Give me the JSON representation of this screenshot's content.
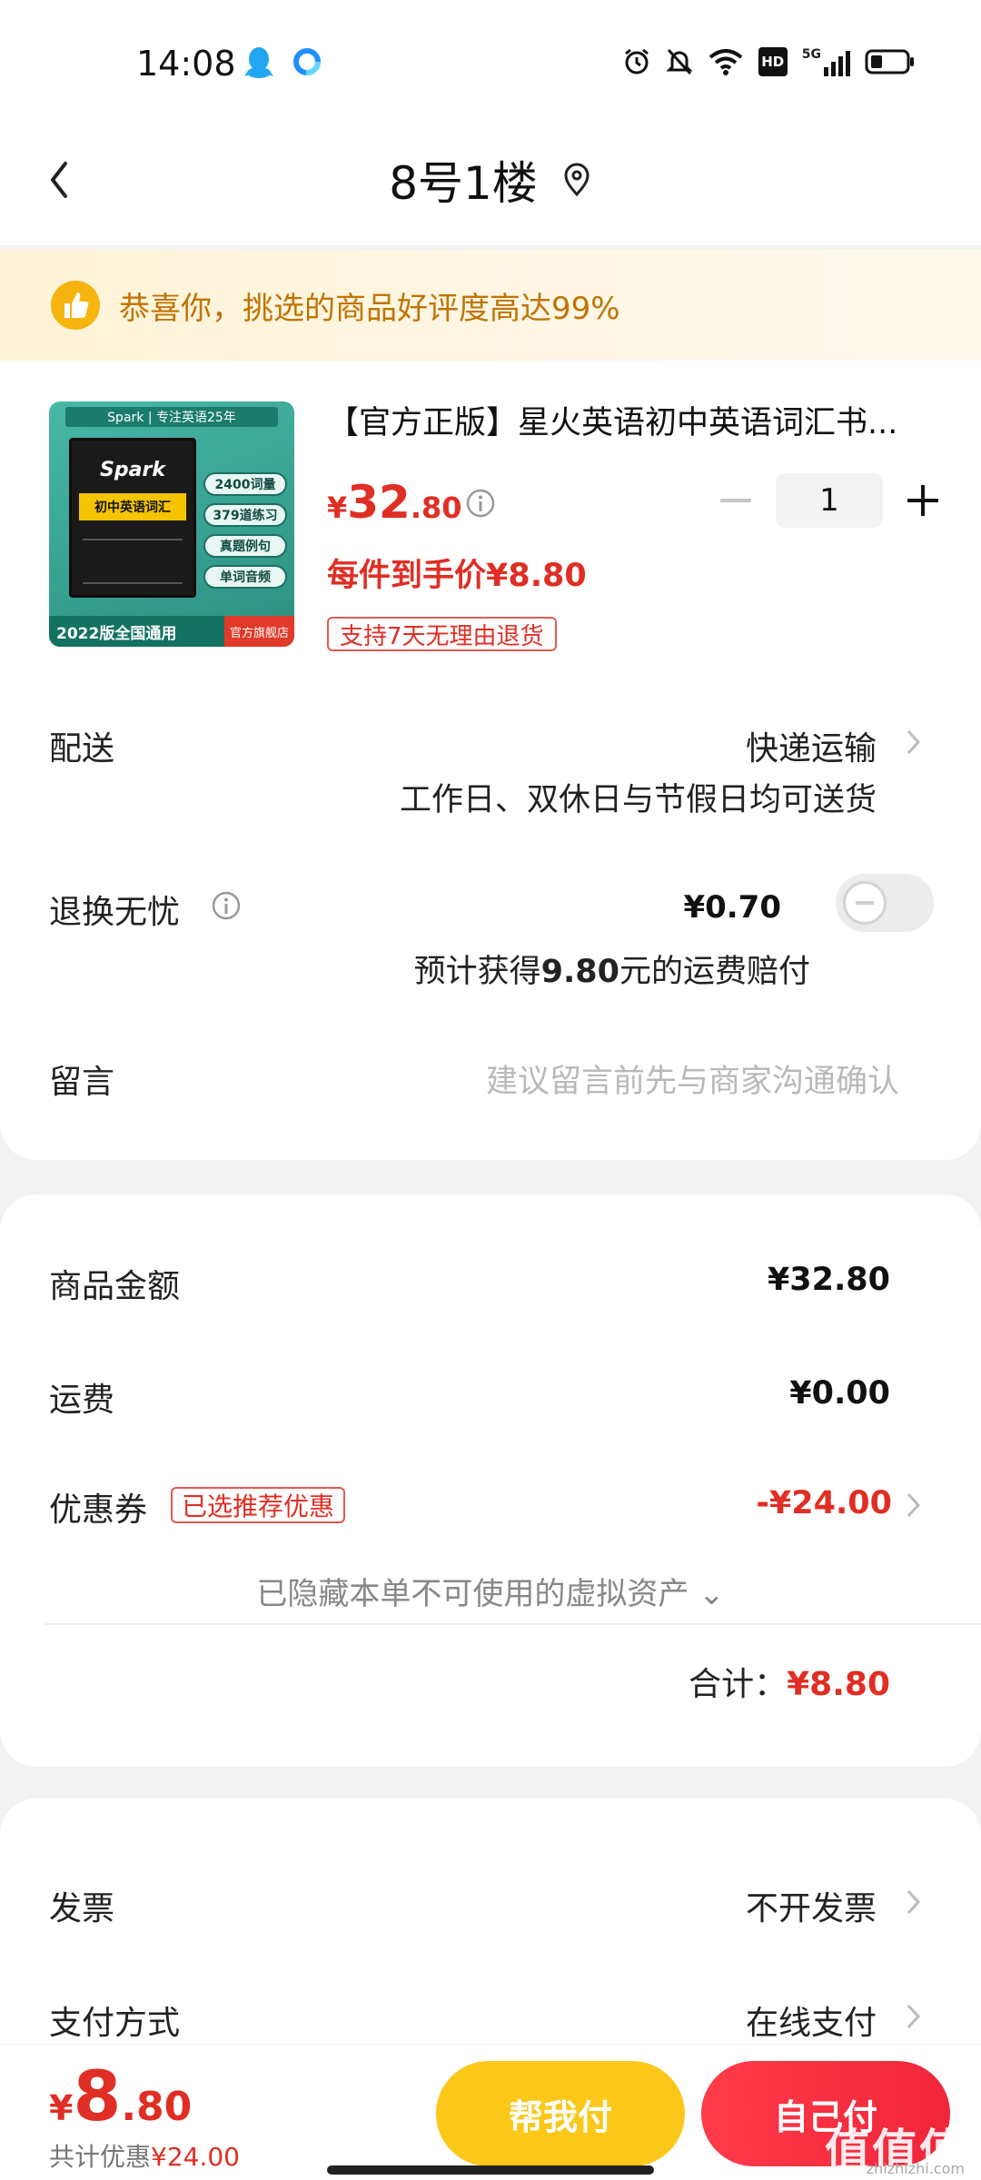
{
  "status_bar": {
    "time": "14:08",
    "hd": "HD",
    "net": "5G"
  },
  "header": {
    "title": "8号1楼"
  },
  "banner": {
    "text": "恭喜你，挑选的商品好评度高达99%"
  },
  "product": {
    "image": {
      "brand_bar": "Spark | 专注英语25年",
      "brand": "Spark",
      "book_title": "初中英语词汇",
      "tags": [
        "2400词量",
        "379道练习",
        "真题例句",
        "单词音频"
      ],
      "edition": "2022版全国通用",
      "store_badge": "官方旗舰店"
    },
    "title": "【官方正版】星火英语初中英语词汇书...",
    "price_currency": "¥",
    "price_int": "32",
    "price_dec": ".80",
    "quantity": "1",
    "unit_price": "每件到手价¥8.80",
    "return_tag": "支持7天无理由退货"
  },
  "delivery": {
    "label": "配送",
    "method": "快递运输",
    "note": "工作日、双休日与节假日均可送货"
  },
  "return_insurance": {
    "label": "退换无忧",
    "fee": "¥0.70",
    "comp_prefix": "预计获得",
    "comp_amount": "9.80",
    "comp_suffix": "元的运费赔付"
  },
  "message": {
    "label": "留言",
    "placeholder": "建议留言前先与商家沟通确认"
  },
  "summary": {
    "goods_label": "商品金额",
    "goods_value": "¥32.80",
    "shipping_label": "运费",
    "shipping_value": "¥0.00",
    "coupon_label": "优惠券",
    "coupon_tag": "已选推荐优惠",
    "coupon_value": "-¥24.00",
    "hidden_assets": "已隐藏本单不可使用的虚拟资产 ⌄",
    "total_label": "合计：",
    "total_value": "¥8.80"
  },
  "invoice": {
    "label": "发票",
    "value": "不开发票"
  },
  "payment": {
    "label": "支付方式",
    "value": "在线支付"
  },
  "bottom": {
    "currency": "¥",
    "total_int": "8",
    "total_dec": ".80",
    "discount_label": "共计优惠",
    "discount_value": "¥24.00",
    "friend_pay": "帮我付",
    "self_pay": "自己付"
  },
  "watermark": {
    "main": "值值值",
    "sub": "zhizhizhi.com"
  },
  "colors": {
    "accent": "#e02e24",
    "yellow": "#fbc81a",
    "banner_text": "#c17300"
  }
}
